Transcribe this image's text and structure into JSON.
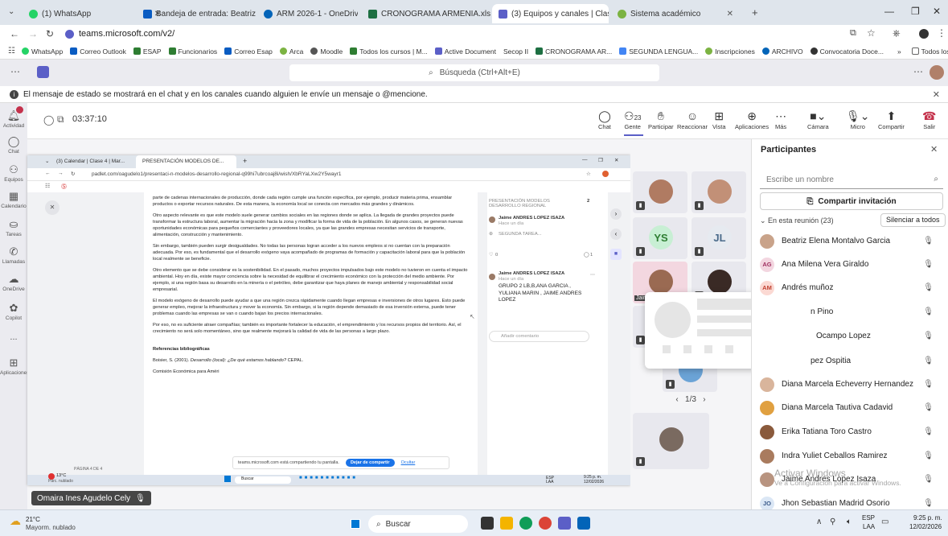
{
  "browser": {
    "tabs": [
      {
        "label": "(1) WhatsApp",
        "color": "#25d366"
      },
      {
        "label": "Bandeja de entrada: Beatriz Ele...",
        "color": "#0a5cc2"
      },
      {
        "label": "ARM 2026-1 - OneDrive",
        "color": "#0364b8"
      },
      {
        "label": "CRONOGRAMA ARMENIA.xlsx",
        "color": "#1d6f42"
      },
      {
        "label": "(3) Equipos y canales | Clas...",
        "color": "#5b5fc7"
      },
      {
        "label": "Sistema académico",
        "color": "#7cb342"
      }
    ],
    "url": "teams.microsoft.com/v2/",
    "bookmarks": [
      "WhatsApp",
      "Correo Outlook",
      "ESAP",
      "Funcionarios",
      "Correo Esap",
      "Arca",
      "Moodle",
      "Todos los cursos | M...",
      "Active Document",
      "Secop II",
      "CRONOGRAMA AR...",
      "SEGUNDA LENGUA...",
      "Inscripciones",
      "ARCHIVO",
      "Convocatoria Doce..."
    ],
    "bookmarks_more": "»",
    "all_favorites": "Todos los favoritos"
  },
  "teams": {
    "search_placeholder": "Búsqueda (Ctrl+Alt+E)",
    "notice": "El mensaje de estado se mostrará en el chat y en los canales cuando alguien le envíe un mensaje o @mencione.",
    "rail": [
      "Actividad",
      "Chat",
      "Equipos",
      "Calendario",
      "Tareas",
      "Llamadas",
      "OneDrive",
      "Copilot",
      "...",
      "Aplicaciones"
    ],
    "timer": "03:37:10",
    "controls": [
      {
        "label": "Chat",
        "icon": "chat-icon"
      },
      {
        "label": "Gente",
        "icon": "people-icon",
        "count": "23"
      },
      {
        "label": "Participar",
        "icon": "hand-icon"
      },
      {
        "label": "Reaccionar",
        "icon": "smile-icon"
      },
      {
        "label": "Vista",
        "icon": "grid-icon"
      },
      {
        "label": "Aplicaciones",
        "icon": "plus-icon"
      },
      {
        "label": "Más",
        "icon": "more-icon"
      },
      {
        "label": "Cámara",
        "icon": "camera-icon"
      },
      {
        "label": "Micro",
        "icon": "mic-icon"
      },
      {
        "label": "Compartir",
        "icon": "share-icon"
      },
      {
        "label": "Salir",
        "icon": "hangup-icon"
      }
    ]
  },
  "shared": {
    "tabs": [
      "(3) Calendar | Clase 4 | Mar...",
      "PRESENTACIÓN MODELOS DE..."
    ],
    "url": "padlet.com/oagudelo1/presentaci-n-modelos-desarrollo-regional-q99hi7ubrcoaj8i/wish/XbRYaLXw2Y5wayr1",
    "doc_paragraphs": [
      "parte de cadenas internacionales de producción, donde cada región cumple una función específica, por ejemplo, producir materia prima, ensamblar productos o exportar recursos naturales. De esta manera, la economía local se conecta con mercados más grandes y dinámicos.",
      "Otro aspecto relevante es que este modelo suele generar cambios sociales en las regiones donde se aplica. La llegada de grandes proyectos puede transformar la estructura laboral, aumentar la migración hacia la zona y modificar la forma de vida de la población. En algunos casos, se generan nuevas oportunidades económicas para pequeños comerciantes y proveedores locales, ya que las grandes empresas necesitan servicios de transporte, alimentación, construcción y mantenimiento.",
      "Sin embargo, también pueden surgir desigualdades. No todas las personas logran acceder a los nuevos empleos si no cuentan con la preparación adecuada. Por eso, es fundamental que el desarrollo exógeno vaya acompañado de programas de formación y capacitación laboral para que la población local realmente se beneficie.",
      "Otro elemento que se debe considerar es la sostenibilidad. En el pasado, muchos proyectos impulsados bajo este modelo no tuvieron en cuenta el impacto ambiental. Hoy en día, existe mayor conciencia sobre la necesidad de equilibrar el crecimiento económico con la protección del medio ambiente. Por ejemplo, si una región basa su desarrollo en la minería o el petróleo, debe garantizar que haya planes de manejo ambiental y responsabilidad social empresarial.",
      "El modelo exógeno de desarrollo puede ayudar a que una región crezca rápidamente cuando llegan empresas e inversiones de otros lugares. Esto puede generar empleo, mejorar la infraestructura y mover la economía. Sin embargo, si la región depende demasiado de esa inversión externa, puede tener problemas cuando las empresas se van o cuando bajan los precios internacionales.",
      "Por eso, no es suficiente atraer compañías; también es importante fortalecer la educación, el emprendimiento y los recursos propios del territorio. Así, el crecimiento no será solo momentáneo, sino que realmente mejorará la calidad de vida de las personas a largo plazo."
    ],
    "refs_title": "Referencias bibliográficas",
    "ref1_pre": "Boisier, S. (2001). ",
    "ref1_em": "Desarrollo (local): ¿De qué estamos hablando?",
    "ref1_post": " CEPAL.",
    "ref2": "Comisión Económica para Améri",
    "page_indicator": "PÁGINA 4 DE 4",
    "panel_title": "PRESENTACIÓN MODELOS DESARROLLO REGIONAL",
    "panel_count": "2",
    "post1_author": "Jaime ANDRES LOPEZ ISAZA",
    "post1_time": "Hace un día",
    "post1_text": "SEGUNDA TAREA...",
    "likes": "0",
    "comments": "1",
    "post2_author": "Jaime ANDRES LOPEZ ISAZA",
    "post2_time": "Hace un día",
    "post2_text": "GRUPO 2 LB,B,ANA GARCIA , YULIANA MARIN , JAIME ANDRES LOPEZ",
    "add_comment": "Añadir comentario",
    "share_notice": "teams.microsoft.com está compartiendo tu pantalla.",
    "stop_share": "Dejar de compartir",
    "hide": "Ocultar",
    "inner_weather_temp": "13°C",
    "inner_weather_desc": "Parc. nublado",
    "inner_search": "Buscar",
    "inner_lang": "ESP\nLAA",
    "inner_time": "9:25 p. m.",
    "inner_date": "12/02/2026"
  },
  "presenter_name": "Omaira Ines Agudelo Cely",
  "gallery": {
    "initials": [
      "YS",
      "JL"
    ],
    "pager": "1/3",
    "jaime_label": "Jaim"
  },
  "participants": {
    "title": "Participantes",
    "search_placeholder": "Escribe un nombre",
    "invite": "Compartir invitación",
    "section": "En esta reunión (23)",
    "mute_all": "Silenciar a todos",
    "people": [
      {
        "name": "Beatriz Elena Montalvo Garcia",
        "initials": "",
        "color": "#c9a38a"
      },
      {
        "name": "Ana Milena Vera Giraldo",
        "initials": "AG",
        "color": "#f3d6e0"
      },
      {
        "name": "Andrés muñoz",
        "initials": "AM",
        "color": "#fbd9d3"
      },
      {
        "name": "n Pino",
        "initials": "",
        "color": "#ccc"
      },
      {
        "name": "Ocampo Lopez",
        "initials": "",
        "color": "#ccc"
      },
      {
        "name": "pez Ospitia",
        "initials": "",
        "color": "#ccc"
      },
      {
        "name": "Diana Marcela Echeverry Hernandez",
        "initials": "",
        "color": "#d9b59c"
      },
      {
        "name": "Diana Marcela Tautiva Cadavid",
        "initials": "",
        "color": "#e0a040"
      },
      {
        "name": "Erika Tatiana Toro Castro",
        "initials": "",
        "color": "#8a5a3c"
      },
      {
        "name": "Indra Yuliet Ceballos Ramirez",
        "initials": "",
        "color": "#a97b5e"
      },
      {
        "name": "Jaime Andres Lopez Isaza",
        "initials": "",
        "color": "#b89480"
      },
      {
        "name": "Jhon Sebastian Madrid Osorio",
        "initials": "JO",
        "color": "#dbe7f5"
      }
    ]
  },
  "activation": {
    "line1": "Activar Windows",
    "line2": "Ve a Configuración para activar Windows."
  },
  "taskbar": {
    "weather_temp": "21°C",
    "weather_desc": "Mayorm. nublado",
    "search": "Buscar",
    "lang1": "ESP",
    "lang2": "LAA",
    "time": "9:25 p. m.",
    "date": "12/02/2026"
  }
}
